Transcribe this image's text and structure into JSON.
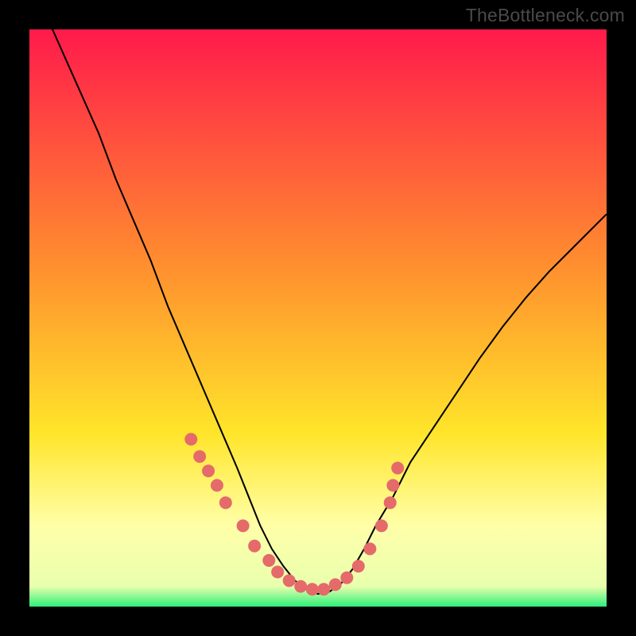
{
  "watermark": "TheBottleneck.com",
  "colors": {
    "top": "#ff1a4b",
    "mid1": "#ff6a2e",
    "mid2": "#ffe52a",
    "pale": "#ffffa8",
    "green": "#2bf07a",
    "curve": "#000000",
    "dot": "#e56a6a"
  },
  "chart_data": {
    "type": "line",
    "title": "",
    "xlabel": "",
    "ylabel": "",
    "xlim": [
      0,
      100
    ],
    "ylim": [
      0,
      100
    ],
    "curve": {
      "name": "bottleneck-curve",
      "x": [
        0,
        4,
        8,
        12,
        15,
        18,
        21,
        24,
        27,
        30,
        33,
        36,
        38,
        40,
        42,
        44,
        46,
        48,
        50,
        52,
        54,
        56,
        58,
        60,
        63,
        66,
        70,
        74,
        78,
        82,
        86,
        90,
        94,
        98,
        100
      ],
      "y": [
        108,
        100,
        91,
        82,
        74,
        67,
        60,
        52,
        45,
        38,
        31,
        24,
        19,
        14,
        10,
        7,
        4.5,
        3,
        2.2,
        2.6,
        4,
        6.5,
        10,
        14,
        19,
        25,
        31,
        37,
        43,
        48.5,
        53.5,
        58,
        62,
        66,
        68
      ]
    },
    "dots": {
      "name": "data-points",
      "x": [
        28,
        29.5,
        31,
        32.5,
        34,
        37,
        39,
        41.5,
        43,
        45,
        47,
        49,
        51,
        53,
        55,
        57,
        59,
        61,
        62.5,
        63,
        63.8
      ],
      "y": [
        29,
        26,
        23.5,
        21,
        18,
        14,
        10.5,
        8,
        6,
        4.5,
        3.5,
        3,
        3,
        3.8,
        5,
        7,
        10,
        14,
        18,
        21,
        24
      ],
      "r": 1.1
    }
  }
}
